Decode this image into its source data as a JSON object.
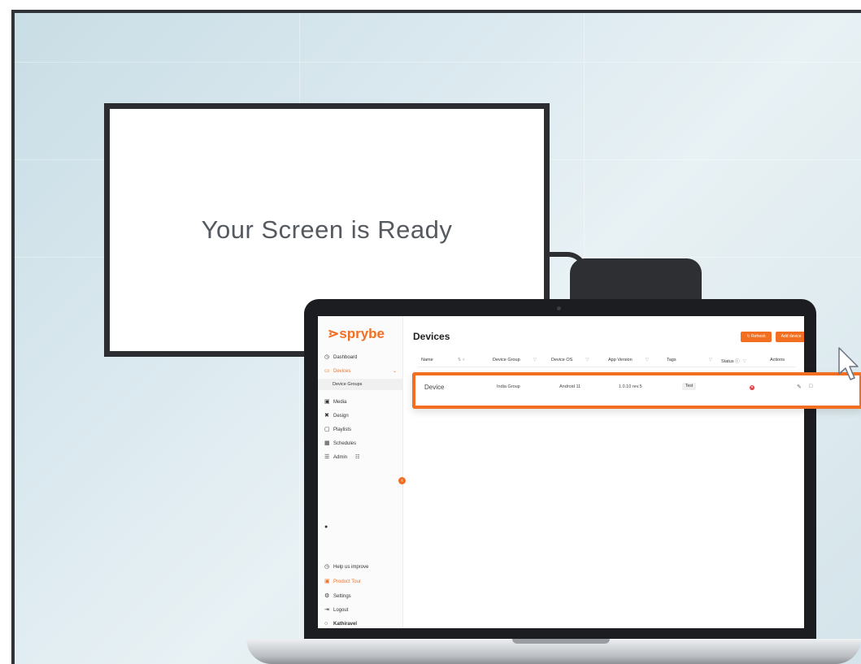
{
  "tv": {
    "message": "Your Screen is Ready"
  },
  "app": {
    "logo": "sprybe",
    "sidebar": {
      "items": [
        {
          "label": "Dashboard",
          "icon": "clock-icon"
        },
        {
          "label": "Devices",
          "icon": "devices-icon",
          "active": true
        },
        {
          "label": "Device Groups",
          "sub": true
        },
        {
          "label": "Media",
          "icon": "media-icon"
        },
        {
          "label": "Design",
          "icon": "design-icon"
        },
        {
          "label": "Playlists",
          "icon": "playlist-icon"
        },
        {
          "label": "Schedules",
          "icon": "calendar-icon"
        },
        {
          "label": "Admin",
          "icon": "admin-icon"
        }
      ],
      "bottom": [
        {
          "label": "Help us improve",
          "icon": "help-icon"
        },
        {
          "label": "Product Tour",
          "icon": "tour-icon",
          "accent": true
        },
        {
          "label": "Settings",
          "icon": "gear-icon"
        },
        {
          "label": "Logout",
          "icon": "logout-icon"
        },
        {
          "label": "Kathiravel",
          "icon": "user-icon"
        }
      ]
    },
    "page_title": "Devices",
    "buttons": {
      "refresh": "Refresh",
      "add": "Add device"
    },
    "table": {
      "columns": [
        "Name",
        "Device Group",
        "Device OS",
        "App Version",
        "Tags",
        "Status",
        "Actions"
      ],
      "rows": [
        {
          "name": "Device",
          "group": "India Group",
          "os": "Android 11",
          "version": "1.0.10 rev.5",
          "tag": "Test",
          "status": "offline"
        }
      ]
    }
  },
  "colors": {
    "accent": "#f26f21",
    "status_offline": "#e23c3c"
  }
}
